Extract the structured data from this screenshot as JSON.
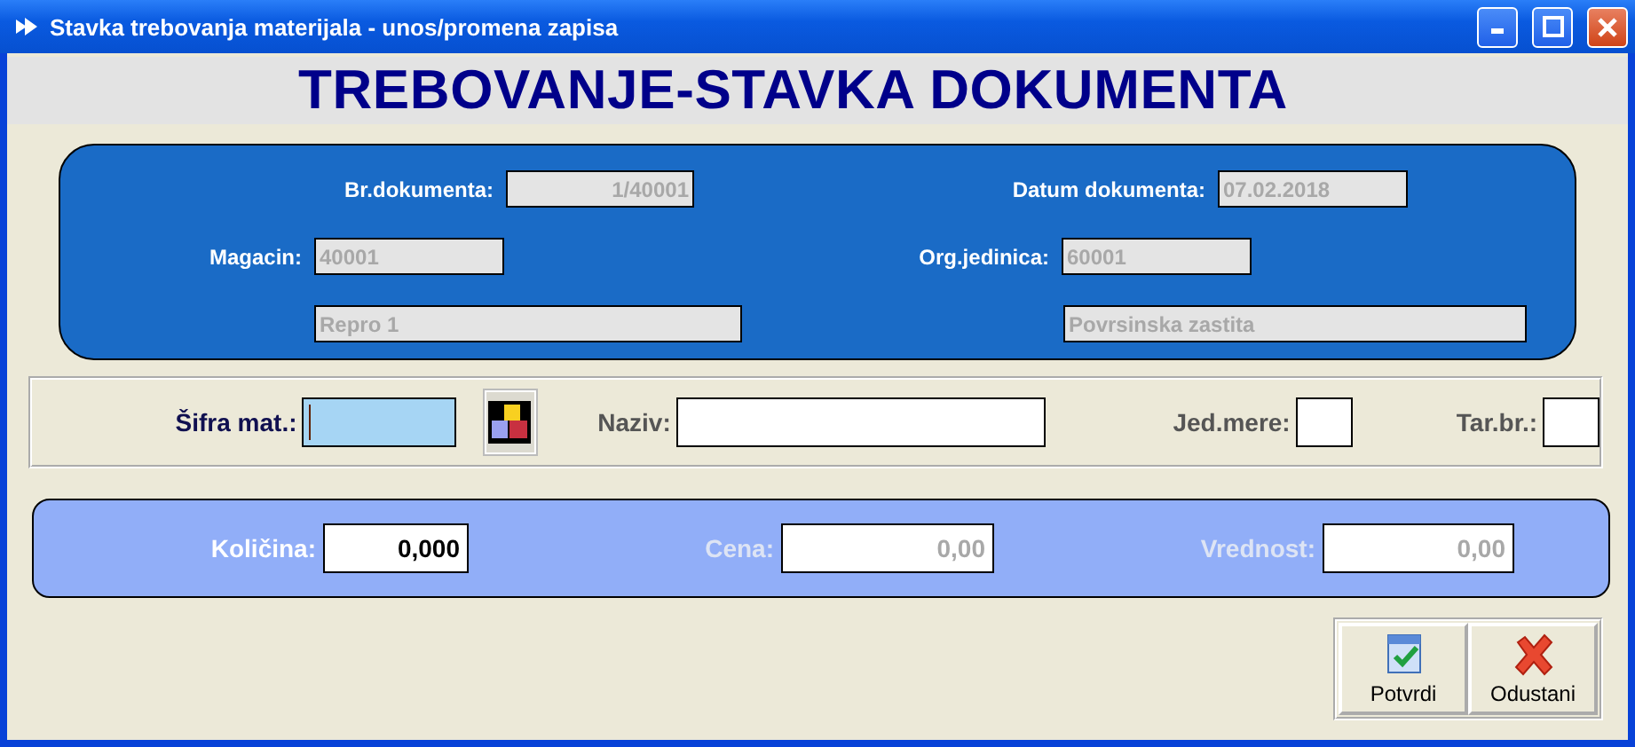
{
  "window": {
    "title": "Stavka trebovanja materijala - unos/promena zapisa"
  },
  "heading": "TREBOVANJE-STAVKA DOKUMENTA",
  "document": {
    "rows": [
      {
        "fields": [
          {
            "label": "Br.dokumenta:",
            "value": "1/40001",
            "disabled": true
          },
          {
            "label": "Datum dokumenta:",
            "value": "07.02.2018",
            "disabled": true
          }
        ]
      },
      {
        "fields": [
          {
            "label": "Magacin:",
            "value": "40001",
            "disabled": true
          },
          {
            "label": "Org.jedinica:",
            "value": "60001",
            "disabled": true
          }
        ]
      },
      {
        "fields": [
          {
            "value": "Repro 1",
            "disabled": true
          },
          {
            "value": "Povrsinska zastita",
            "disabled": true
          }
        ]
      }
    ]
  },
  "material": {
    "fields": [
      {
        "label": "Šifra mat.:",
        "focused": true,
        "lookup": true
      },
      {
        "label": "Naziv:",
        "focused": false,
        "lookup": false
      },
      {
        "label": "Jed.mere:",
        "focused": false,
        "lookup": false
      },
      {
        "label": "Tar.br.:",
        "focused": false,
        "lookup": false
      }
    ]
  },
  "amounts": [
    {
      "label": "Količina:",
      "value": "0,000",
      "disabled": false
    },
    {
      "label": "Cena:",
      "value": "0,00",
      "disabled": true
    },
    {
      "label": "Vrednost:",
      "value": "0,00",
      "disabled": true
    }
  ],
  "buttons": [
    {
      "kind": "confirm",
      "label": "Potvrdi"
    },
    {
      "kind": "cancel",
      "label": "Odustani"
    }
  ]
}
